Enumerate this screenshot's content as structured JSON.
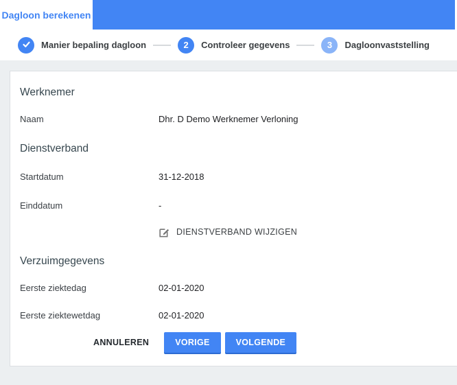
{
  "colors": {
    "accent": "#4285f4",
    "accent_light": "#8ab4f8",
    "page_bg": "#eceff1"
  },
  "tabbar": {
    "active_tab": "Dagloon berekenen"
  },
  "stepper": {
    "steps": [
      {
        "label": "Manier bepaling dagloon",
        "state": "done",
        "icon": "check-icon"
      },
      {
        "number": "2",
        "label": "Controleer gegevens",
        "state": "active"
      },
      {
        "number": "3",
        "label": "Dagloonvaststelling",
        "state": "upcoming"
      }
    ]
  },
  "form": {
    "sections": [
      {
        "title": "Werknemer",
        "fields": [
          {
            "label": "Naam",
            "value": "Dhr. D Demo Werknemer Verloning"
          }
        ]
      },
      {
        "title": "Dienstverband",
        "fields": [
          {
            "label": "Startdatum",
            "value": "31-12-2018"
          },
          {
            "label": "Einddatum",
            "value": "-"
          }
        ],
        "action_label": "DIENSTVERBAND WIJZIGEN"
      },
      {
        "title": "Verzuimgegevens",
        "fields": [
          {
            "label": "Eerste ziektedag",
            "value": "02-01-2020"
          },
          {
            "label": "Eerste ziektewetdag",
            "value": "02-01-2020"
          }
        ]
      }
    ],
    "buttons": {
      "cancel": "ANNULEREN",
      "previous": "VORIGE",
      "next": "VOLGENDE"
    }
  }
}
